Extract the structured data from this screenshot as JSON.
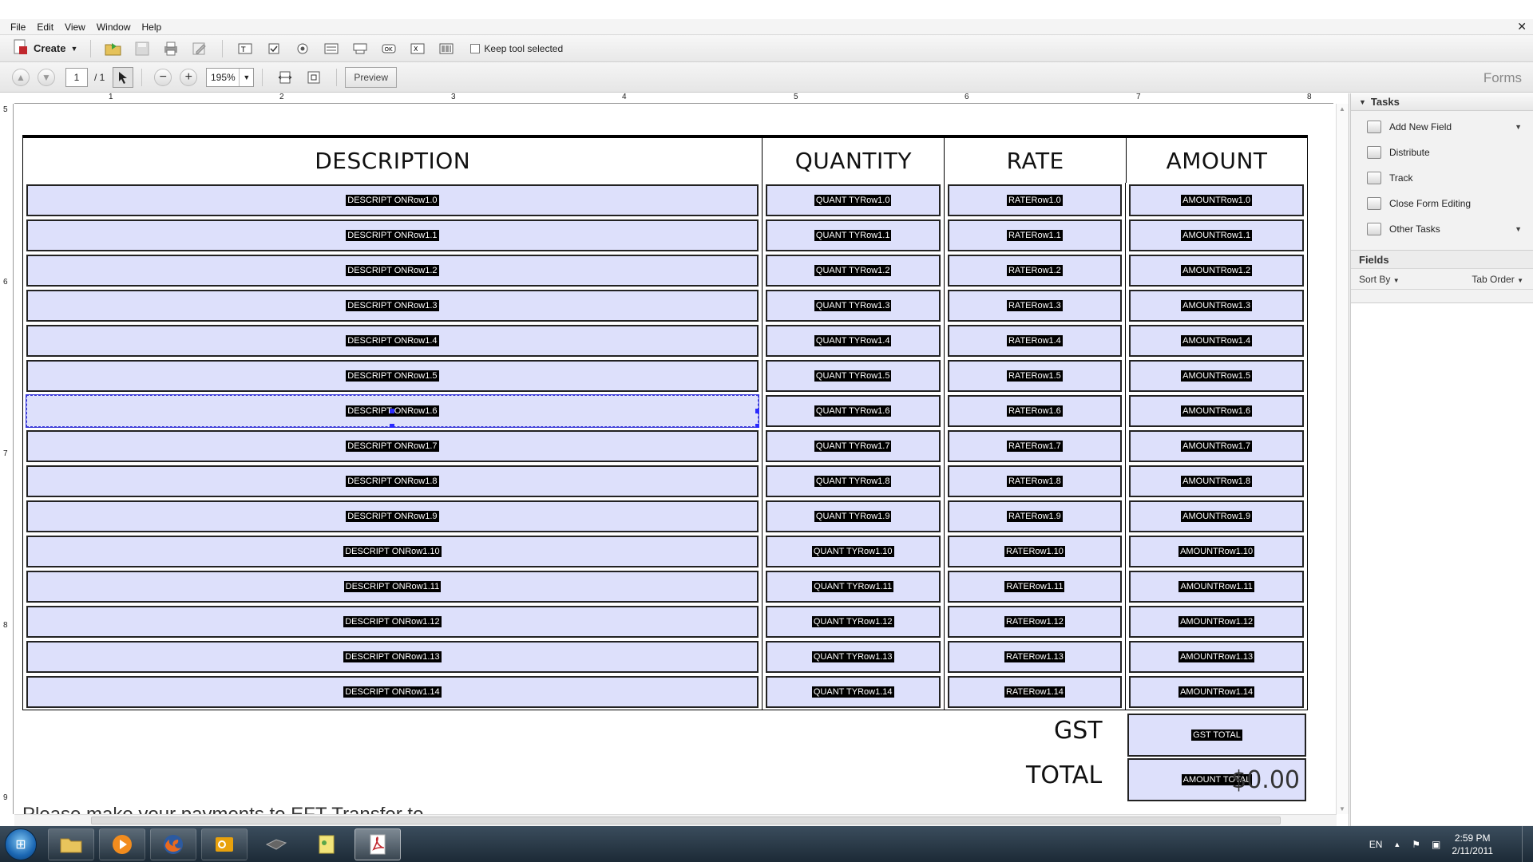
{
  "menu": [
    "File",
    "Edit",
    "View",
    "Window",
    "Help"
  ],
  "toolbar": {
    "create_label": "Create",
    "keep_tool_label": "Keep tool selected"
  },
  "nav": {
    "page_current": "1",
    "page_total": "/ 1",
    "zoom": "195%",
    "preview_label": "Preview",
    "forms_label": "Forms"
  },
  "ruler": {
    "top": [
      "1",
      "2",
      "3",
      "4",
      "5",
      "6",
      "7",
      "8"
    ],
    "left": [
      "5",
      "6",
      "7",
      "8",
      "9"
    ]
  },
  "form": {
    "headers": [
      "DESCRIPTION",
      "QUANTITY",
      "RATE",
      "AMOUNT"
    ],
    "rows": [
      [
        "DESCRIPT ONRow1.0",
        "QUANT TYRow1.0",
        "RATERow1.0",
        "AMOUNTRow1.0"
      ],
      [
        "DESCRIPT ONRow1.1",
        "QUANT TYRow1.1",
        "RATERow1.1",
        "AMOUNTRow1.1"
      ],
      [
        "DESCRIPT ONRow1.2",
        "QUANT TYRow1.2",
        "RATERow1.2",
        "AMOUNTRow1.2"
      ],
      [
        "DESCRIPT ONRow1.3",
        "QUANT TYRow1.3",
        "RATERow1.3",
        "AMOUNTRow1.3"
      ],
      [
        "DESCRIPT ONRow1.4",
        "QUANT TYRow1.4",
        "RATERow1.4",
        "AMOUNTRow1.4"
      ],
      [
        "DESCRIPT ONRow1.5",
        "QUANT TYRow1.5",
        "RATERow1.5",
        "AMOUNTRow1.5"
      ],
      [
        "DESCRIPT ONRow1.6",
        "QUANT TYRow1.6",
        "RATERow1.6",
        "AMOUNTRow1.6"
      ],
      [
        "DESCRIPT ONRow1.7",
        "QUANT TYRow1.7",
        "RATERow1.7",
        "AMOUNTRow1.7"
      ],
      [
        "DESCRIPT ONRow1.8",
        "QUANT TYRow1.8",
        "RATERow1.8",
        "AMOUNTRow1.8"
      ],
      [
        "DESCRIPT ONRow1.9",
        "QUANT TYRow1.9",
        "RATERow1.9",
        "AMOUNTRow1.9"
      ],
      [
        "DESCRIPT ONRow1.10",
        "QUANT TYRow1.10",
        "RATERow1.10",
        "AMOUNTRow1.10"
      ],
      [
        "DESCRIPT ONRow1.11",
        "QUANT TYRow1.11",
        "RATERow1.11",
        "AMOUNTRow1.11"
      ],
      [
        "DESCRIPT ONRow1.12",
        "QUANT TYRow1.12",
        "RATERow1.12",
        "AMOUNTRow1.12"
      ],
      [
        "DESCRIPT ONRow1.13",
        "QUANT TYRow1.13",
        "RATERow1.13",
        "AMOUNTRow1.13"
      ],
      [
        "DESCRIPT ONRow1.14",
        "QUANT TYRow1.14",
        "RATERow1.14",
        "AMOUNTRow1.14"
      ]
    ],
    "selected_row": 6,
    "gst_label": "GST",
    "gst_field": "GST TOTAL",
    "total_label": "TOTAL",
    "total_field": "AMOUNT TOTAL",
    "total_value": "$0.00",
    "footer_text": "Please make your payments to EFT Transfer to"
  },
  "panel": {
    "tasks_title": "Tasks",
    "tasks": [
      {
        "label": "Add New Field",
        "icon": "add-field-icon",
        "dropdown": true
      },
      {
        "label": "Distribute",
        "icon": "distribute-icon",
        "dropdown": false
      },
      {
        "label": "Track",
        "icon": "track-icon",
        "dropdown": false
      },
      {
        "label": "Close Form Editing",
        "icon": "close-form-icon",
        "dropdown": false
      },
      {
        "label": "Other Tasks",
        "icon": "other-tasks-icon",
        "dropdown": true
      }
    ],
    "fields_title": "Fields",
    "sort_by": "Sort By",
    "tab_order": "Tab Order"
  },
  "taskbar": {
    "lang": "EN",
    "time": "2:59 PM",
    "date": "2/11/2011"
  },
  "colors": {
    "field_bg": "#dde0fb",
    "selection": "#2a2aff"
  }
}
